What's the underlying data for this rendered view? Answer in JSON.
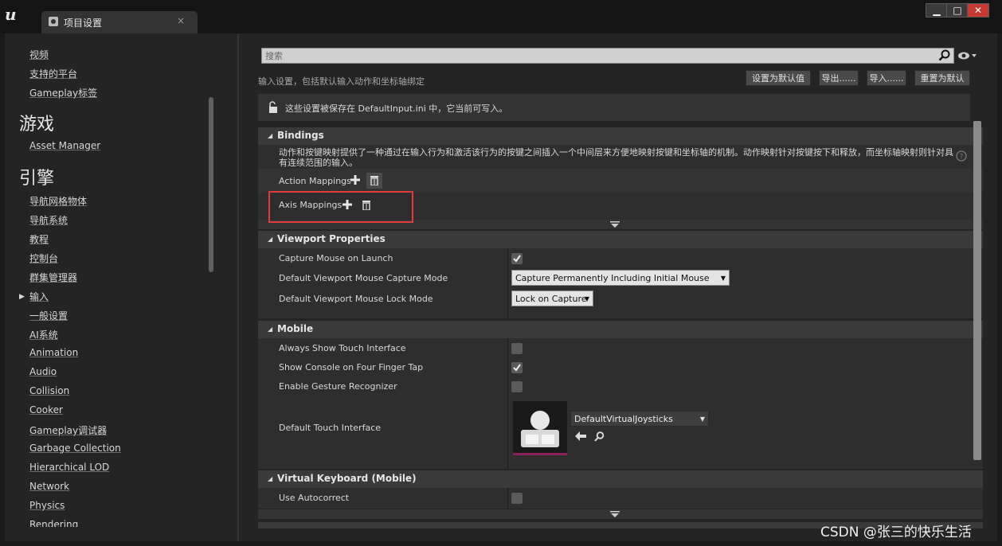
{
  "window": {
    "tab_title": "项目设置",
    "tab_close": "×",
    "btn_min": "▁",
    "btn_max": "□",
    "btn_close": "✕"
  },
  "sidebar": {
    "items_top": [
      "视频",
      "支持的平台",
      "Gameplay标签"
    ],
    "game_heading": "游戏",
    "game_items": [
      "Asset Manager"
    ],
    "engine_heading": "引擎",
    "engine_items": [
      "导航网格物体",
      "导航系统",
      "教程",
      "控制台",
      "群集管理器",
      "输入",
      "一般设置",
      "AI系统",
      "Animation",
      "Audio",
      "Collision",
      "Cooker",
      "Gameplay调试器",
      "Garbage Collection",
      "Hierarchical LOD",
      "Network",
      "Physics",
      "Rendering"
    ],
    "selected": "输入"
  },
  "search": {
    "placeholder": "搜索"
  },
  "header": {
    "description": "输入设置，包括默认输入动作和坐标轴绑定",
    "set_default": "设置为默认值",
    "export": "导出......",
    "import": "导入......",
    "reset": "重置为默认"
  },
  "notice": {
    "text": "这些设置被保存在 DefaultInput.ini 中，它当前可写入。"
  },
  "bindings": {
    "title": "Bindings",
    "description_line1": "动作和按键映射提供了一种通过在输入行为和激活该行为的按键之间插入一个中间层来方便地映射按键和坐标轴的机制。动作映射针对按键按下和释放，而坐标轴映射则针对具",
    "description_line2": "有连续范围的输入。",
    "action_mappings": "Action Mappings",
    "axis_mappings": "Axis Mappings"
  },
  "viewport": {
    "title": "Viewport Properties",
    "capture_mouse": "Capture Mouse on Launch",
    "capture_mouse_checked": true,
    "capture_mode_label": "Default Viewport Mouse Capture Mode",
    "capture_mode_value": "Capture Permanently Including Initial Mouse Down",
    "lock_mode_label": "Default Viewport Mouse Lock Mode",
    "lock_mode_value": "Lock on Capture"
  },
  "mobile": {
    "title": "Mobile",
    "always_show_touch": "Always Show Touch Interface",
    "always_show_touch_checked": false,
    "show_console": "Show Console on Four Finger Tap",
    "show_console_checked": true,
    "gesture": "Enable Gesture Recognizer",
    "gesture_checked": false,
    "touch_interface_label": "Default Touch Interface",
    "touch_interface_value": "DefaultVirtualJoysticks"
  },
  "virtual_keyboard": {
    "title": "Virtual Keyboard (Mobile)",
    "autocorrect": "Use Autocorrect",
    "autocorrect_checked": false
  },
  "watermark": "CSDN @张三的快乐生活",
  "colors": {
    "highlight": "#e03c3c",
    "panel": "#242424",
    "accent_thumb": "#8a1f5a"
  }
}
